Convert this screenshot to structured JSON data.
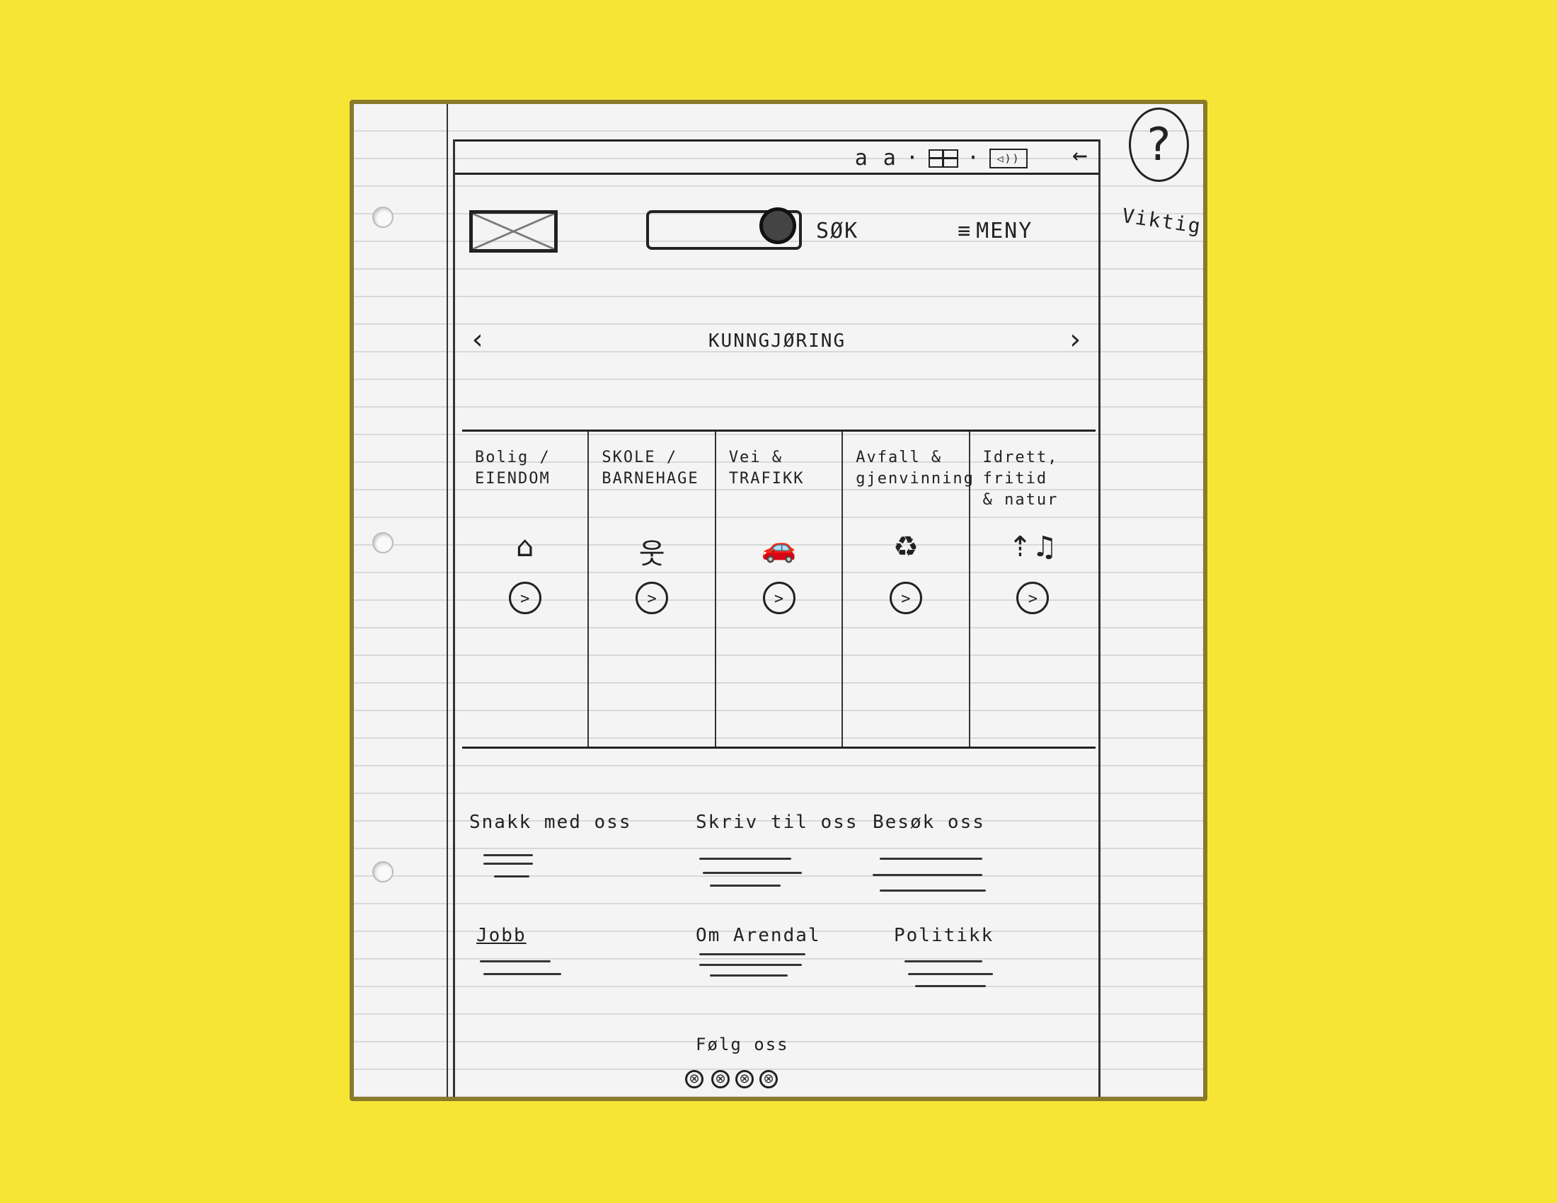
{
  "topbar": {
    "font_size_toggle": "a a",
    "sep": "·",
    "speaker_label": "◁))"
  },
  "header": {
    "search_label": "SØK",
    "menu_label": "MENY",
    "menu_icon": "≡"
  },
  "carousel": {
    "prev": "‹",
    "next": "›",
    "text": "KUNNGJØRING"
  },
  "categories": [
    {
      "line1": "Bolig /",
      "line2": "EIENDOM",
      "icon": "⌂",
      "btn": ">"
    },
    {
      "line1": "SKOLE /",
      "line2": "BARNEHAGE",
      "icon": "웃",
      "btn": ">"
    },
    {
      "line1": "Vei &",
      "line2": "TRAFIKK",
      "icon": "🚗",
      "btn": ">"
    },
    {
      "line1": "Avfall &",
      "line2": "gjenvinning",
      "icon": "♻",
      "btn": ">"
    },
    {
      "line1": "Idrett, fritid",
      "line2": "& natur",
      "icon": "⇡♫",
      "btn": ">"
    }
  ],
  "footer": {
    "chat": "Snakk med oss",
    "write": "Skriv til oss",
    "visit": "Besøk oss",
    "job": "Jobb",
    "about": "Om Arendal",
    "politics": "Politikk",
    "follow": "Følg oss",
    "social_icons": [
      "⊗",
      "⊗",
      "⊗",
      "⊗"
    ]
  },
  "annotation": {
    "help": "?",
    "arrow": "←",
    "note": "Viktig?"
  }
}
